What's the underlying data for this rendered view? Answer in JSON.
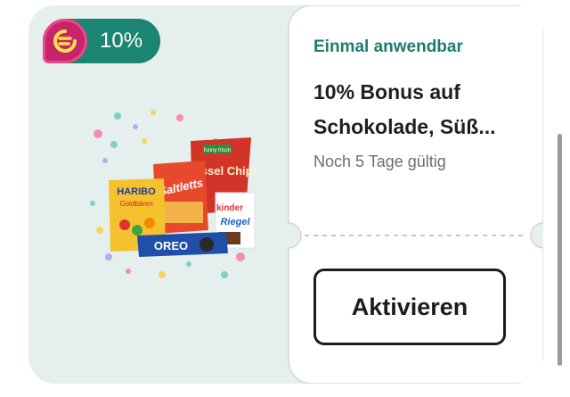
{
  "badge": {
    "logo_icon": "rewards-logo-icon",
    "label": "10%",
    "accent_color": "#1b8472",
    "logo_color": "#c8246a"
  },
  "illustration": {
    "icon": "sweets-snacks-illustration",
    "product_texts": [
      "HARIBO",
      "Goldbären",
      "Saltletts",
      "funny frisch",
      "Kessel Chips",
      "kinder",
      "Riegel",
      "OREO"
    ]
  },
  "offer": {
    "applicability": "Einmal anwendbar",
    "title_line1": "10% Bonus auf",
    "title_line2": "Schokolade, Süß...",
    "validity": "Noch 5 Tage gültig",
    "activate_label": "Aktivieren"
  }
}
